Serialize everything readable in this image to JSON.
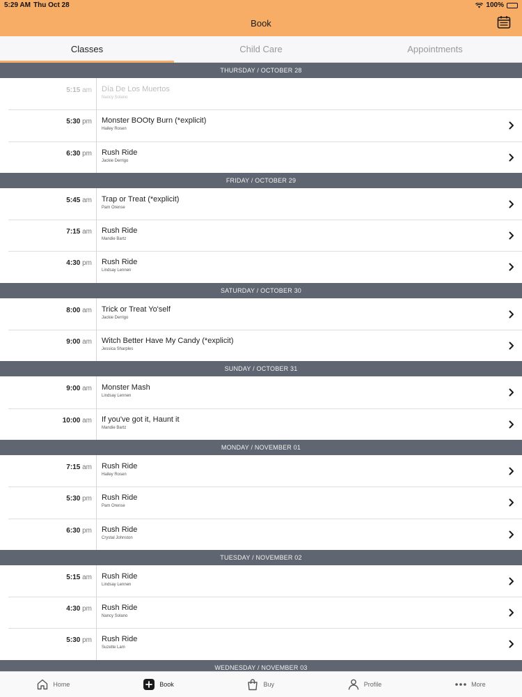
{
  "status": {
    "time": "5:29 AM",
    "date": "Thu Oct 28",
    "battery": "100%"
  },
  "nav": {
    "title": "Book"
  },
  "tabs": [
    {
      "label": "Classes",
      "active": true
    },
    {
      "label": "Child Care",
      "active": false
    },
    {
      "label": "Appointments",
      "active": false
    }
  ],
  "days": [
    {
      "header": "THURSDAY / OCTOBER 28",
      "classes": [
        {
          "time": "5:15",
          "ampm": "am",
          "name": "Día De Los Muertos",
          "instructor": "Nancy Solano",
          "disabled": true
        },
        {
          "time": "5:30",
          "ampm": "pm",
          "name": "Monster BOOty Burn (*explicit)",
          "instructor": "Hailey Rosen"
        },
        {
          "time": "6:30",
          "ampm": "pm",
          "name": "Rush Ride",
          "instructor": "Jackie Derrigo"
        }
      ]
    },
    {
      "header": "FRIDAY / OCTOBER 29",
      "classes": [
        {
          "time": "5:45",
          "ampm": "am",
          "name": "Trap or Treat (*explicit)",
          "instructor": "Pam Orense"
        },
        {
          "time": "7:15",
          "ampm": "am",
          "name": "Rush Ride",
          "instructor": "Mandie Bartz"
        },
        {
          "time": "4:30",
          "ampm": "pm",
          "name": "Rush Ride",
          "instructor": "Lindsay Lennen"
        }
      ]
    },
    {
      "header": "SATURDAY / OCTOBER 30",
      "classes": [
        {
          "time": "8:00",
          "ampm": "am",
          "name": "Trick or Treat Yo'self",
          "instructor": "Jackie Derrigo"
        },
        {
          "time": "9:00",
          "ampm": "am",
          "name": "Witch Better Have My Candy (*explicit)",
          "instructor": "Jessica Sharples"
        }
      ]
    },
    {
      "header": "SUNDAY / OCTOBER 31",
      "classes": [
        {
          "time": "9:00",
          "ampm": "am",
          "name": "Monster Mash",
          "instructor": "Lindsay Lennen"
        },
        {
          "time": "10:00",
          "ampm": "am",
          "name": "If you've got it, Haunt it",
          "instructor": "Mandie Bartz"
        }
      ]
    },
    {
      "header": "MONDAY / NOVEMBER 01",
      "classes": [
        {
          "time": "7:15",
          "ampm": "am",
          "name": "Rush Ride",
          "instructor": "Hailey Rosen"
        },
        {
          "time": "5:30",
          "ampm": "pm",
          "name": "Rush Ride",
          "instructor": "Pam Orense"
        },
        {
          "time": "6:30",
          "ampm": "pm",
          "name": "Rush Ride",
          "instructor": "Crystal Johnston"
        }
      ]
    },
    {
      "header": "TUESDAY / NOVEMBER 02",
      "classes": [
        {
          "time": "5:15",
          "ampm": "am",
          "name": "Rush Ride",
          "instructor": "Lindsay Lennen"
        },
        {
          "time": "4:30",
          "ampm": "pm",
          "name": "Rush Ride",
          "instructor": "Nancy Solano"
        },
        {
          "time": "5:30",
          "ampm": "pm",
          "name": "Rush Ride",
          "instructor": "Suzette Lam"
        }
      ]
    },
    {
      "header": "WEDNESDAY / NOVEMBER 03",
      "classes": []
    }
  ],
  "tabbar": [
    {
      "label": "Home",
      "icon": "home-icon",
      "active": false
    },
    {
      "label": "Book",
      "icon": "book-plus-icon",
      "active": true
    },
    {
      "label": "Buy",
      "icon": "shopping-bag-icon",
      "active": false
    },
    {
      "label": "Profile",
      "icon": "person-icon",
      "active": false
    },
    {
      "label": "More",
      "icon": "more-dots-icon",
      "active": false
    }
  ],
  "colors": {
    "accent": "#f7ad66",
    "day_header": "#5f6571"
  }
}
